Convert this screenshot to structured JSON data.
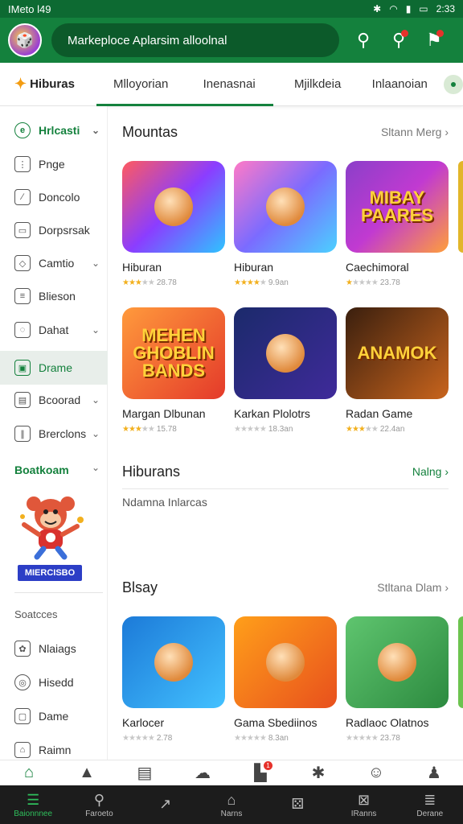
{
  "status_bar": {
    "left": "IMeto l49",
    "time": "2:33"
  },
  "header": {
    "search_text": "Markeploce Aplarsim alloolnal"
  },
  "tabs": {
    "brand": "Hiburas",
    "items": [
      "Mlloyorian",
      "Inenasnai",
      "Mjilkdeia",
      "Inlaanoian"
    ]
  },
  "sidebar": {
    "items": [
      "Hrlcasti",
      "Pnge",
      "Doncolo",
      "Dorpsrsak",
      "Camtio",
      "Blieson",
      "Dahat",
      "Drame",
      "Bcoorad",
      "Brerclons"
    ],
    "section": "Boatkoam",
    "promo": "MIERCISBO",
    "section2": "Soatcces",
    "items2": [
      "Nlaiags",
      "Hisedd",
      "Dame",
      "Raimn"
    ]
  },
  "main": {
    "sections": [
      {
        "title": "Mountas",
        "more": "Sltann Merg",
        "cards": [
          {
            "name": "Hiburan",
            "rating": "28.78",
            "stars_on": 3,
            "bg": "linear-gradient(135deg,#ff5a5f,#8b3dff,#2ec4ff)",
            "art": ""
          },
          {
            "name": "Hiburan",
            "rating": "9.9an",
            "stars_on": 4,
            "bg": "linear-gradient(135deg,#ff7ac6,#7b6bff,#4bd1ff)",
            "art": ""
          },
          {
            "name": "Caechimoral",
            "rating": "23.78",
            "stars_on": 1,
            "bg": "linear-gradient(135deg,#8b3fc9,#c13ad1,#ff9f3a)",
            "art": "MIBAY PAARES"
          }
        ]
      },
      {
        "title": "",
        "more": "",
        "cards": [
          {
            "name": "Margan Dlbunan",
            "rating": "15.78",
            "stars_on": 3,
            "bg": "linear-gradient(135deg,#ff9a3c,#e43a2a)",
            "art": "MEHEN GHOBLIN BANDS"
          },
          {
            "name": "Karkan Plolotrs",
            "rating": "18.3an",
            "stars_on": 0,
            "bg": "linear-gradient(135deg,#1b2a6b,#3f2a9a)",
            "art": ""
          },
          {
            "name": "Radan Game",
            "rating": "22.4an",
            "stars_on": 3,
            "bg": "linear-gradient(135deg,#3a1f0e,#c8641d)",
            "art": "ANAMOK"
          }
        ]
      }
    ],
    "hiburans": {
      "title": "Hiburans",
      "more": "Nalng",
      "note": "Ndamna Inlarcas"
    },
    "blay": {
      "title": "Blsay",
      "more": "Stltana Dlam",
      "cards": [
        {
          "name": "Karlocer",
          "rating": "2.78",
          "stars_on": 0,
          "bg": "linear-gradient(135deg,#1c7ad8,#43c1ff)",
          "art": ""
        },
        {
          "name": "Gama Sbediinos",
          "rating": "8.3an",
          "stars_on": 0,
          "bg": "linear-gradient(135deg,#ff9f1a,#e8501d)",
          "art": ""
        },
        {
          "name": "Radlaoc Olatnos",
          "rating": "23.78",
          "stars_on": 0,
          "bg": "linear-gradient(135deg,#5fc56f,#2c8a3f)",
          "art": ""
        }
      ]
    }
  },
  "system_nav": [
    "Baionnnee",
    "Faroeto",
    "",
    "Narns",
    "",
    "IRanns",
    "Derane"
  ],
  "colors": {
    "primary": "#14813d",
    "primary_dark": "#0d6a32"
  }
}
